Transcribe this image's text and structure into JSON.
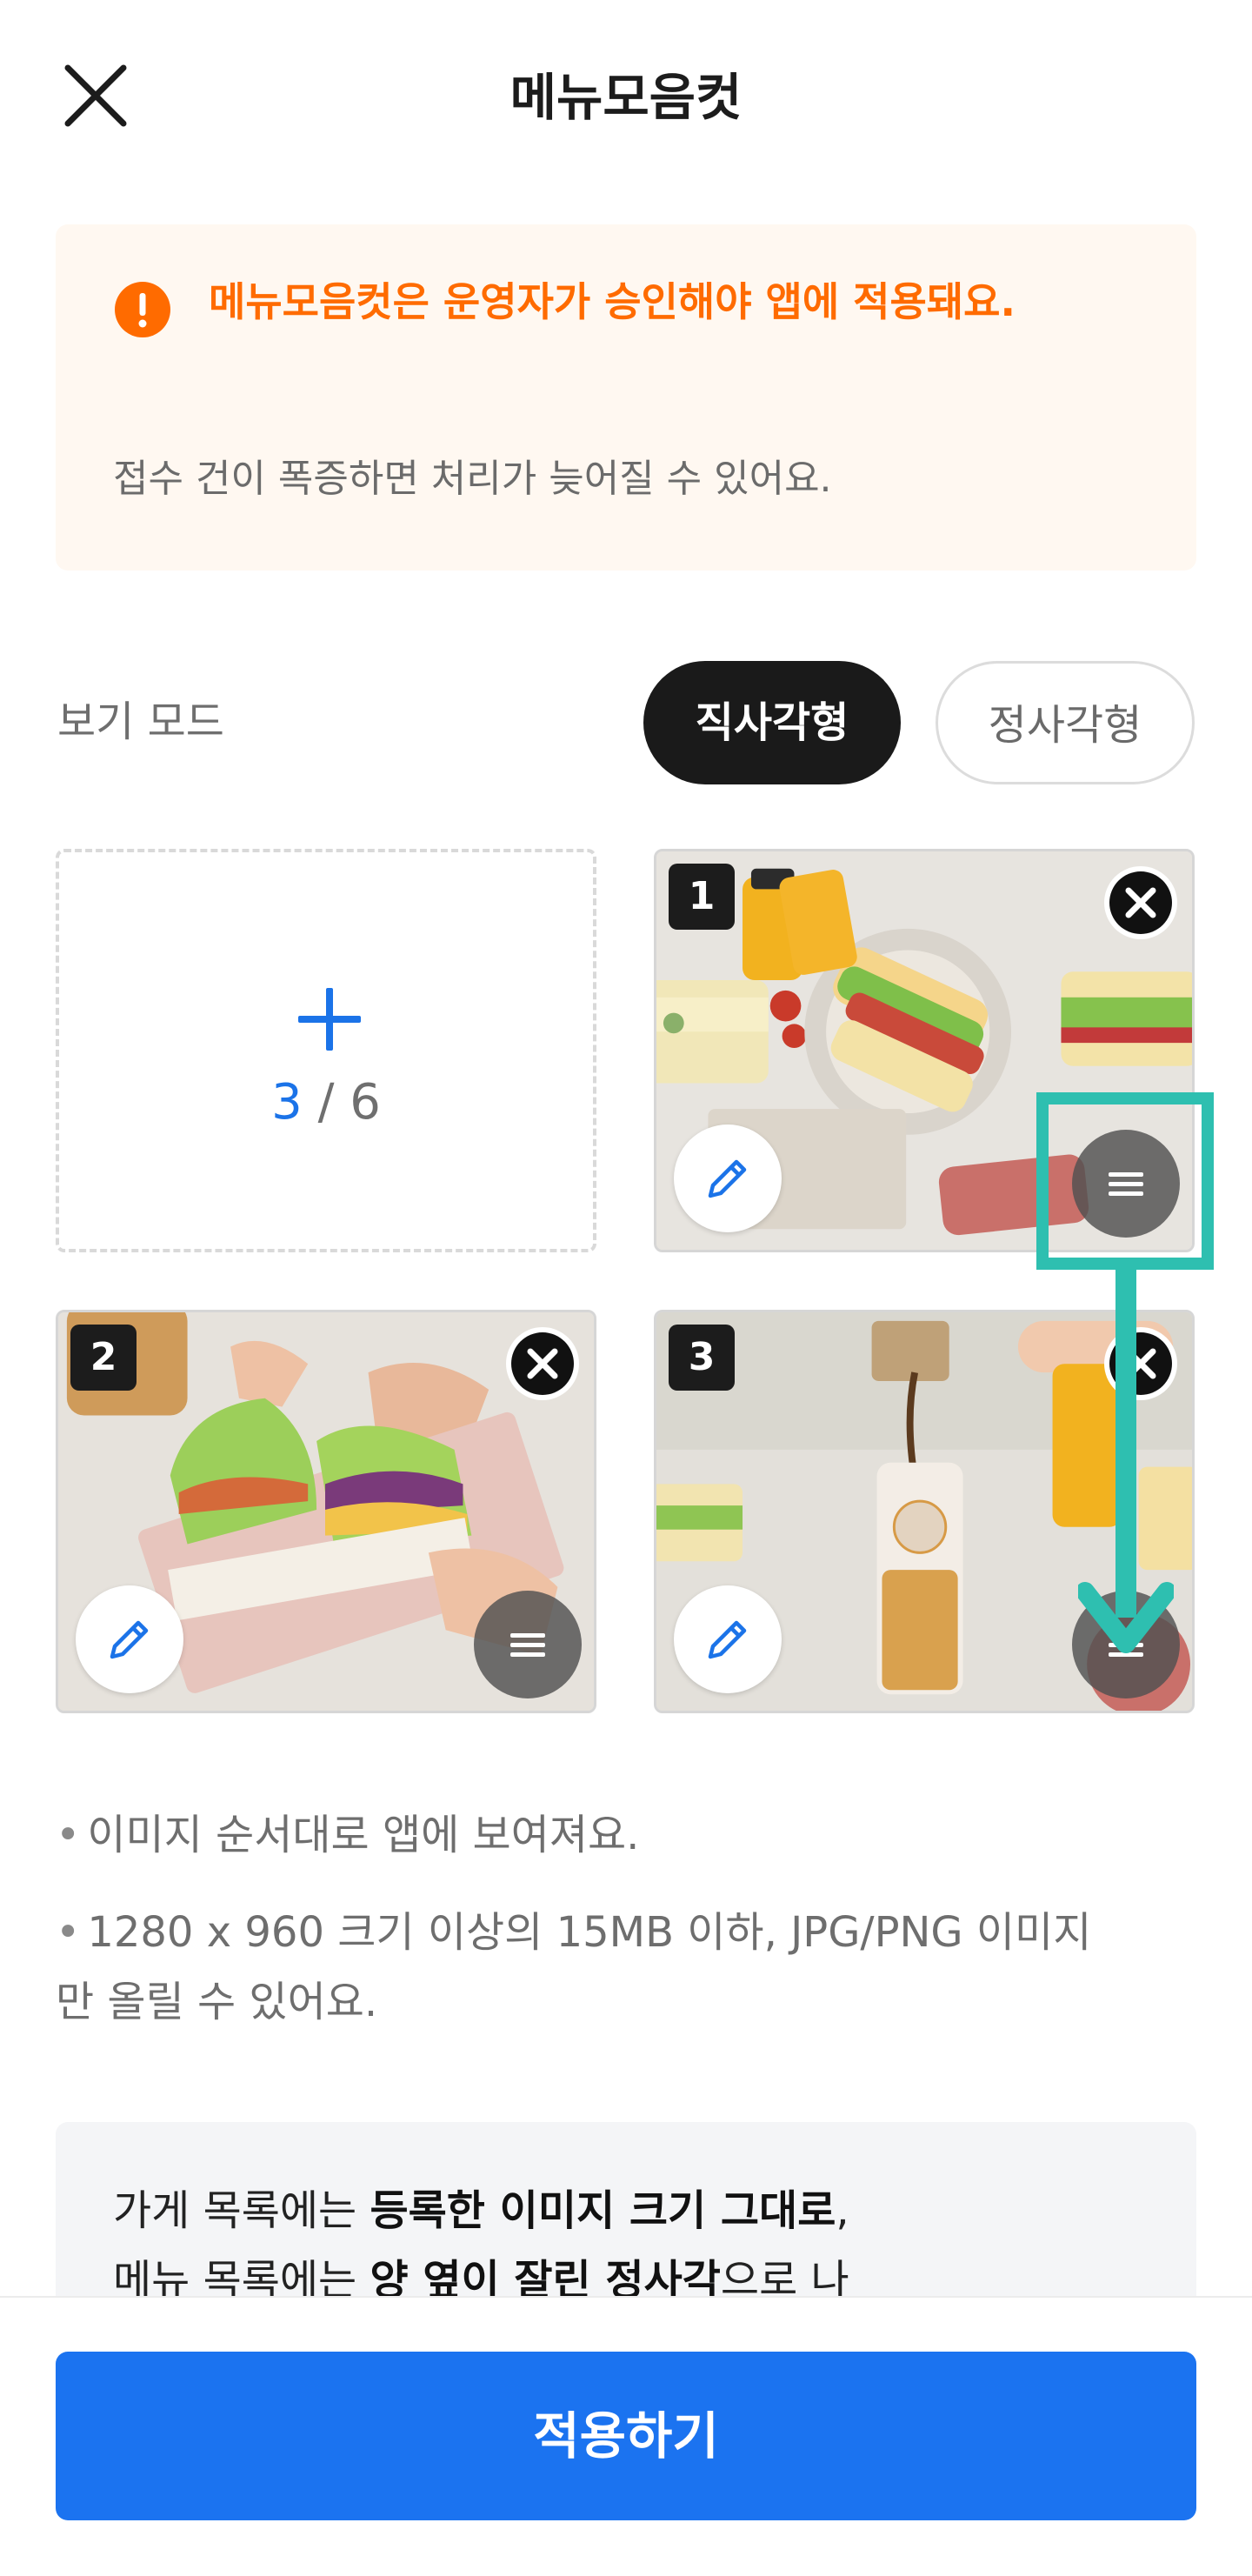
{
  "header": {
    "title": "메뉴모음컷",
    "close_icon": "close-icon"
  },
  "notice": {
    "icon": "exclamation-circle-icon",
    "title": "메뉴모음컷은 운영자가 승인해야 앱에 적용돼요.",
    "description": "접수 건이 폭증하면 처리가 늦어질 수 있어요."
  },
  "view_mode": {
    "label": "보기 모드",
    "options": [
      "직사각형",
      "정사각형"
    ],
    "selected": "직사각형"
  },
  "gallery": {
    "add_tile": {
      "icon": "plus-icon",
      "count_current": "3",
      "count_separator": " / ",
      "count_max": "6"
    },
    "photos": [
      {
        "number": "1",
        "subject": "sandwiches and juice bottles, top view"
      },
      {
        "number": "2",
        "subject": "hands holding a cut sandwich in a box"
      },
      {
        "number": "3",
        "subject": "coffee poured into a bottle with a sandwich"
      }
    ],
    "icons": {
      "delete": "close-circle-icon",
      "edit": "pencil-icon",
      "reorder": "drag-handle-icon"
    }
  },
  "guidelines": [
    "이미지 순서대로 앱에 보여져요.",
    "1280 x 960 크기 이상의 15MB 이하, JPG/PNG 이미지",
    "만 올릴 수 있어요."
  ],
  "info": {
    "line1_pre": "가게 목록에는 ",
    "line1_bold": "등록한 이미지 크기 그대로",
    "line1_post": ",",
    "line2_pre": "메뉴 목록에는 ",
    "line2_bold": "양 옆이 잘린 정사각",
    "line2_post": "으로 나"
  },
  "apply_button": "적용하기",
  "colors": {
    "accent": "#1b73f0",
    "warning": "#ff6b00",
    "notice_bg": "#fff8f1",
    "highlight": "#2ebfb0",
    "dark": "#1a1a1a"
  }
}
